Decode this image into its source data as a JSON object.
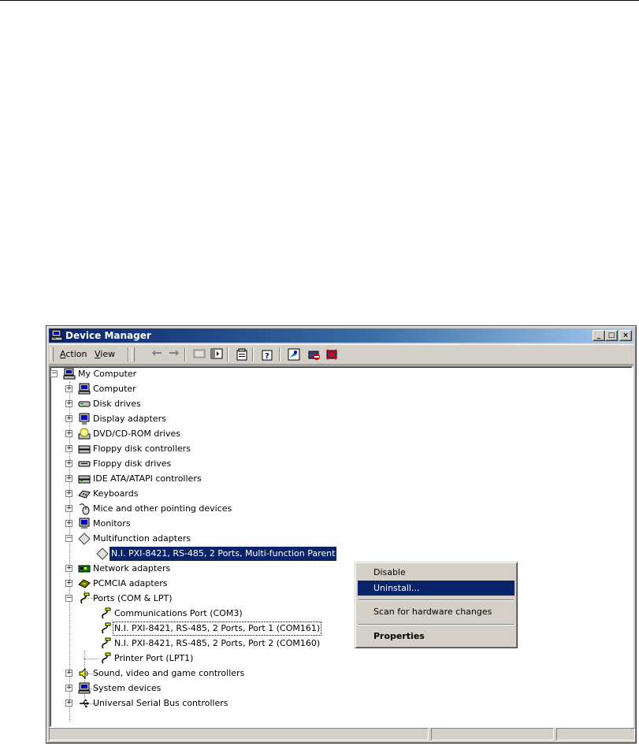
{
  "window": {
    "title": "Device Manager",
    "controls": {
      "minimize": "_",
      "maximize": "□",
      "close": "×"
    }
  },
  "toolbar": {
    "menus": [
      {
        "label_pre": "",
        "mnemonic": "A",
        "label_post": "ction"
      },
      {
        "label_pre": "",
        "mnemonic": "V",
        "label_post": "iew"
      }
    ],
    "buttons": [
      "back-arrow-icon",
      "forward-arrow-icon",
      "up-folder-icon",
      "show-hide-tree-icon",
      "properties-icon",
      "help-icon",
      "scan-hardware-icon",
      "disable-device-icon",
      "uninstall-device-icon"
    ]
  },
  "tree": {
    "root": "My Computer",
    "items": [
      {
        "label": "Computer",
        "icon": "computer-icon"
      },
      {
        "label": "Disk drives",
        "icon": "disk-drive-icon"
      },
      {
        "label": "Display adapters",
        "icon": "display-adapter-icon"
      },
      {
        "label": "DVD/CD-ROM drives",
        "icon": "cdrom-icon"
      },
      {
        "label": "Floppy disk controllers",
        "icon": "floppy-controller-icon"
      },
      {
        "label": "Floppy disk drives",
        "icon": "floppy-drive-icon"
      },
      {
        "label": "IDE ATA/ATAPI controllers",
        "icon": "ide-controller-icon"
      },
      {
        "label": "Keyboards",
        "icon": "keyboard-icon"
      },
      {
        "label": "Mice and other pointing devices",
        "icon": "mouse-icon"
      },
      {
        "label": "Monitors",
        "icon": "monitor-icon"
      },
      {
        "label": "Multifunction adapters",
        "icon": "multifunction-icon"
      },
      {
        "label": "N.I. PXI-8421, RS-485, 2 Ports, Multi-function Parent",
        "icon": "multifunction-device-icon"
      },
      {
        "label": "Network adapters",
        "icon": "network-adapter-icon"
      },
      {
        "label": "PCMCIA adapters",
        "icon": "pcmcia-icon"
      },
      {
        "label": "Ports (COM & LPT)",
        "icon": "port-icon"
      },
      {
        "label": "Communications Port (COM3)",
        "icon": "port-icon"
      },
      {
        "label": "N.I. PXI-8421, RS-485, 2 Ports, Port 1 (COM161)",
        "icon": "port-icon"
      },
      {
        "label": "N.I. PXI-8421, RS-485, 2 Ports, Port 2 (COM160)",
        "icon": "port-icon"
      },
      {
        "label": "Printer Port (LPT1)",
        "icon": "port-icon"
      },
      {
        "label": "Sound, video and game controllers",
        "icon": "sound-icon"
      },
      {
        "label": "System devices",
        "icon": "system-device-icon"
      },
      {
        "label": "Universal Serial Bus controllers",
        "icon": "usb-icon"
      }
    ]
  },
  "context_menu": {
    "items": [
      "Disable",
      "Uninstall...",
      "Scan for hardware changes",
      "Properties"
    ],
    "highlighted": "Uninstall..."
  },
  "colors": {
    "selection": "#0a246a",
    "face": "#d4d0c8",
    "title_start": "#0a246a",
    "title_end": "#a6caf0"
  }
}
